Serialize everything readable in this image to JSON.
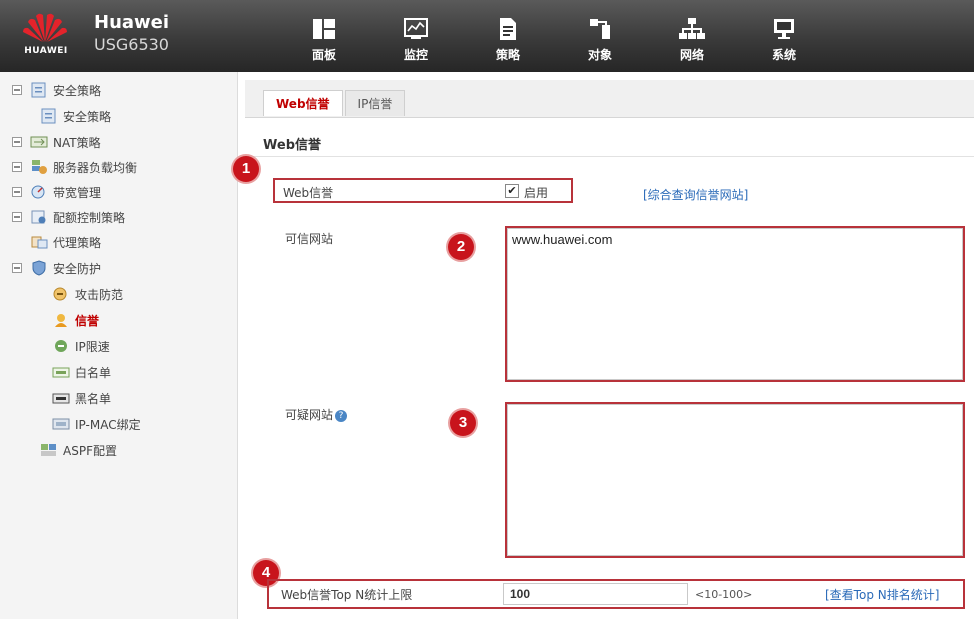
{
  "header": {
    "brand_logo_text": "HUAWEI",
    "product_name": "Huawei",
    "product_model": "USG6530",
    "nav": [
      {
        "label": "面板",
        "icon": "dashboard-icon"
      },
      {
        "label": "监控",
        "icon": "monitor-icon"
      },
      {
        "label": "策略",
        "icon": "policy-icon"
      },
      {
        "label": "对象",
        "icon": "object-icon"
      },
      {
        "label": "网络",
        "icon": "network-icon"
      },
      {
        "label": "系统",
        "icon": "system-icon"
      }
    ]
  },
  "sidebar": {
    "items": [
      {
        "label": "安全策略",
        "level": 0,
        "expander": true,
        "icon": "security-policy-icon"
      },
      {
        "label": "安全策略",
        "level": 1,
        "expander": false,
        "icon": "security-policy-icon"
      },
      {
        "label": "NAT策略",
        "level": 0,
        "expander": true,
        "icon": "nat-policy-icon"
      },
      {
        "label": "服务器负载均衡",
        "level": 0,
        "expander": true,
        "icon": "load-balance-icon"
      },
      {
        "label": "带宽管理",
        "level": 0,
        "expander": true,
        "icon": "bandwidth-icon"
      },
      {
        "label": "配额控制策略",
        "level": 0,
        "expander": true,
        "icon": "quota-control-icon"
      },
      {
        "label": "代理策略",
        "level": 0,
        "expander": false,
        "icon": "proxy-policy-icon"
      },
      {
        "label": "安全防护",
        "level": 0,
        "expander": true,
        "icon": "shield-icon"
      },
      {
        "label": "攻击防范",
        "level": 1,
        "expander": false,
        "icon": "attack-defense-icon"
      },
      {
        "label": "信誉",
        "level": 1,
        "expander": false,
        "icon": "reputation-icon",
        "active": true
      },
      {
        "label": "IP限速",
        "level": 1,
        "expander": false,
        "icon": "ip-rate-limit-icon"
      },
      {
        "label": "白名单",
        "level": 1,
        "expander": false,
        "icon": "whitelist-icon"
      },
      {
        "label": "黑名单",
        "level": 1,
        "expander": false,
        "icon": "blacklist-icon"
      },
      {
        "label": "IP-MAC绑定",
        "level": 1,
        "expander": false,
        "icon": "ip-mac-binding-icon"
      },
      {
        "label": "ASPF配置",
        "level": 0,
        "expander": false,
        "icon": "aspf-icon"
      }
    ]
  },
  "main": {
    "tabs": [
      {
        "label": "Web信誉",
        "active": true
      },
      {
        "label": "IP信誉",
        "active": false
      }
    ],
    "panel_title": "Web信誉",
    "web_reputation": {
      "label": "Web信誉",
      "enable_label": "启用",
      "enabled": true,
      "query_link": "[综合查询信誉网站]"
    },
    "trusted_sites": {
      "label": "可信网站",
      "value": "www.huawei.com"
    },
    "suspicious_sites": {
      "label": "可疑网站",
      "value": ""
    },
    "top_n": {
      "label": "Web信誉Top N统计上限",
      "value": "100",
      "range": "<10-100>",
      "link": "[查看Top N排名统计]"
    },
    "badges": [
      "1",
      "2",
      "3",
      "4"
    ]
  },
  "colors": {
    "accent_red": "#c8141c",
    "annotation_red": "#b8323a",
    "link_blue": "#2a6ab8",
    "header_dark": "#333333"
  }
}
